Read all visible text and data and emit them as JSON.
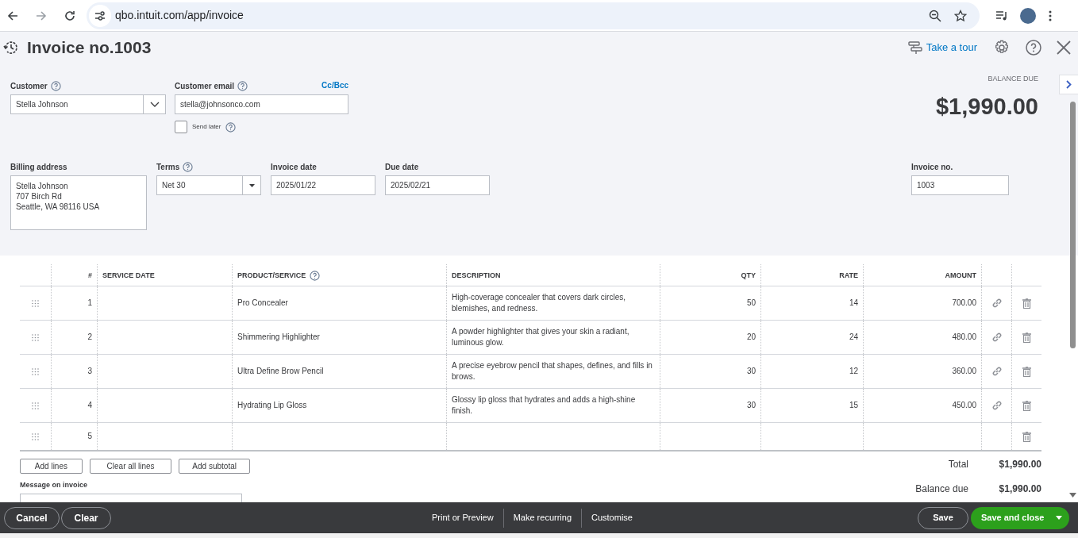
{
  "browser": {
    "url": "qbo.intuit.com/app/invoice"
  },
  "header": {
    "title": "Invoice no.1003",
    "tour_link": "Take a tour"
  },
  "customer": {
    "label": "Customer",
    "value": "Stella Johnson"
  },
  "customer_email": {
    "label": "Customer email",
    "value": "stella@johnsonco.com",
    "cc_link": "Cc/Bcc"
  },
  "send_later": {
    "label": "Send later",
    "checked": false
  },
  "balance": {
    "label": "BALANCE DUE",
    "amount": "$1,990.00"
  },
  "billing_address": {
    "label": "Billing address",
    "lines": [
      "Stella Johnson",
      "707 Birch Rd",
      "Seattle, WA  98116 USA"
    ]
  },
  "terms": {
    "label": "Terms",
    "value": "Net 30"
  },
  "invoice_date": {
    "label": "Invoice date",
    "value": "2025/01/22"
  },
  "due_date": {
    "label": "Due date",
    "value": "2025/02/21"
  },
  "invoice_no": {
    "label": "Invoice no.",
    "value": "1003"
  },
  "table": {
    "columns": [
      "#",
      "SERVICE DATE",
      "PRODUCT/SERVICE",
      "DESCRIPTION",
      "QTY",
      "RATE",
      "AMOUNT"
    ],
    "rows": [
      {
        "number": "1",
        "product": "Pro Concealer",
        "description": "High-coverage concealer that covers dark circles, blemishes, and redness.",
        "qty": "50",
        "rate": "14",
        "amount": "700.00"
      },
      {
        "number": "2",
        "product": "Shimmering Highlighter",
        "description": "A powder highlighter that gives your skin a radiant, luminous glow.",
        "qty": "20",
        "rate": "24",
        "amount": "480.00"
      },
      {
        "number": "3",
        "product": "Ultra Define Brow Pencil",
        "description": "A precise eyebrow pencil that shapes, defines, and fills in brows.",
        "qty": "30",
        "rate": "12",
        "amount": "360.00"
      },
      {
        "number": "4",
        "product": "Hydrating Lip Gloss",
        "description": "Glossy lip gloss that hydrates and adds a high-shine finish.",
        "qty": "30",
        "rate": "15",
        "amount": "450.00"
      },
      {
        "number": "5"
      }
    ]
  },
  "line_buttons": [
    "Add lines",
    "Clear all lines",
    "Add subtotal"
  ],
  "message": {
    "label": "Message on invoice"
  },
  "totals": [
    {
      "label": "Total",
      "value": "$1,990.00"
    },
    {
      "label": "Balance due",
      "value": "$1,990.00"
    }
  ],
  "footer": {
    "left_buttons": [
      "Cancel",
      "Clear"
    ],
    "center_links": [
      "Print or Preview",
      "Make recurring",
      "Customise"
    ],
    "save": "Save",
    "save_close": "Save and close"
  }
}
